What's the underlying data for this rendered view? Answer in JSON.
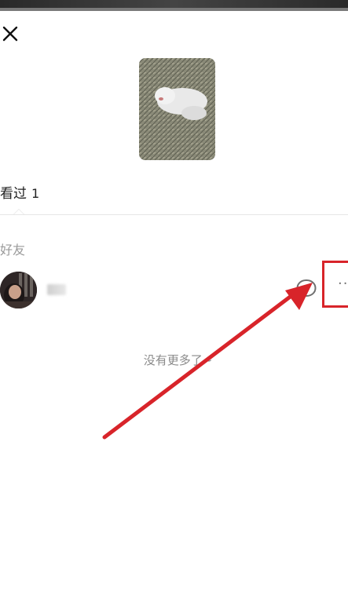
{
  "header": {
    "close_icon": "close-icon"
  },
  "media": {
    "thumbnail_icon": "photo-thumbnail"
  },
  "tabs": [
    {
      "label": "看过",
      "count": "1"
    }
  ],
  "friends_section": {
    "title": "好友"
  },
  "friend_row": {
    "avatar_icon": "avatar",
    "name": "",
    "comment_icon": "comment-icon",
    "more_label": "··"
  },
  "footer": {
    "no_more_text": "没有更多了~"
  },
  "colors": {
    "highlight": "#d8242a",
    "text_primary": "#222222",
    "text_secondary": "#9a9a9a",
    "divider": "#e6e6e6"
  }
}
